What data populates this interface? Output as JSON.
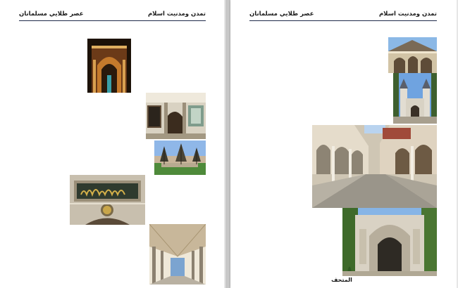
{
  "pages": {
    "left": {
      "header_right": "تمدن ومدنيت اسلام",
      "header_left": "عصر طلايي مسلمانان",
      "images": [
        {
          "name": "gate-night-photo",
          "subject": "arched gate lit at night"
        },
        {
          "name": "courtyard-entrance-photo",
          "subject": "palace entrance with tiled walls"
        },
        {
          "name": "garden-trees-photo",
          "subject": "courtyard garden with trees"
        },
        {
          "name": "calligraphy-gate-photo",
          "subject": "gate with Arabic calligraphy inscription"
        },
        {
          "name": "colonnade-walkway-photo",
          "subject": "covered colonnade walkway"
        }
      ]
    },
    "right": {
      "header_right": "تمدن ومدنيت اسلام",
      "header_left": "عصر طلايي مسلمانان",
      "caption": "المتحف",
      "images": [
        {
          "name": "pavilion-facade-photo",
          "subject": "ornate pavilion facade"
        },
        {
          "name": "twin-tower-gate-photo",
          "subject": "gate flanked by two towers"
        },
        {
          "name": "arcade-courtyard-photo",
          "subject": "arcaded courtyard with columns"
        },
        {
          "name": "ornate-portal-photo",
          "subject": "decorated marble portal"
        }
      ]
    }
  }
}
